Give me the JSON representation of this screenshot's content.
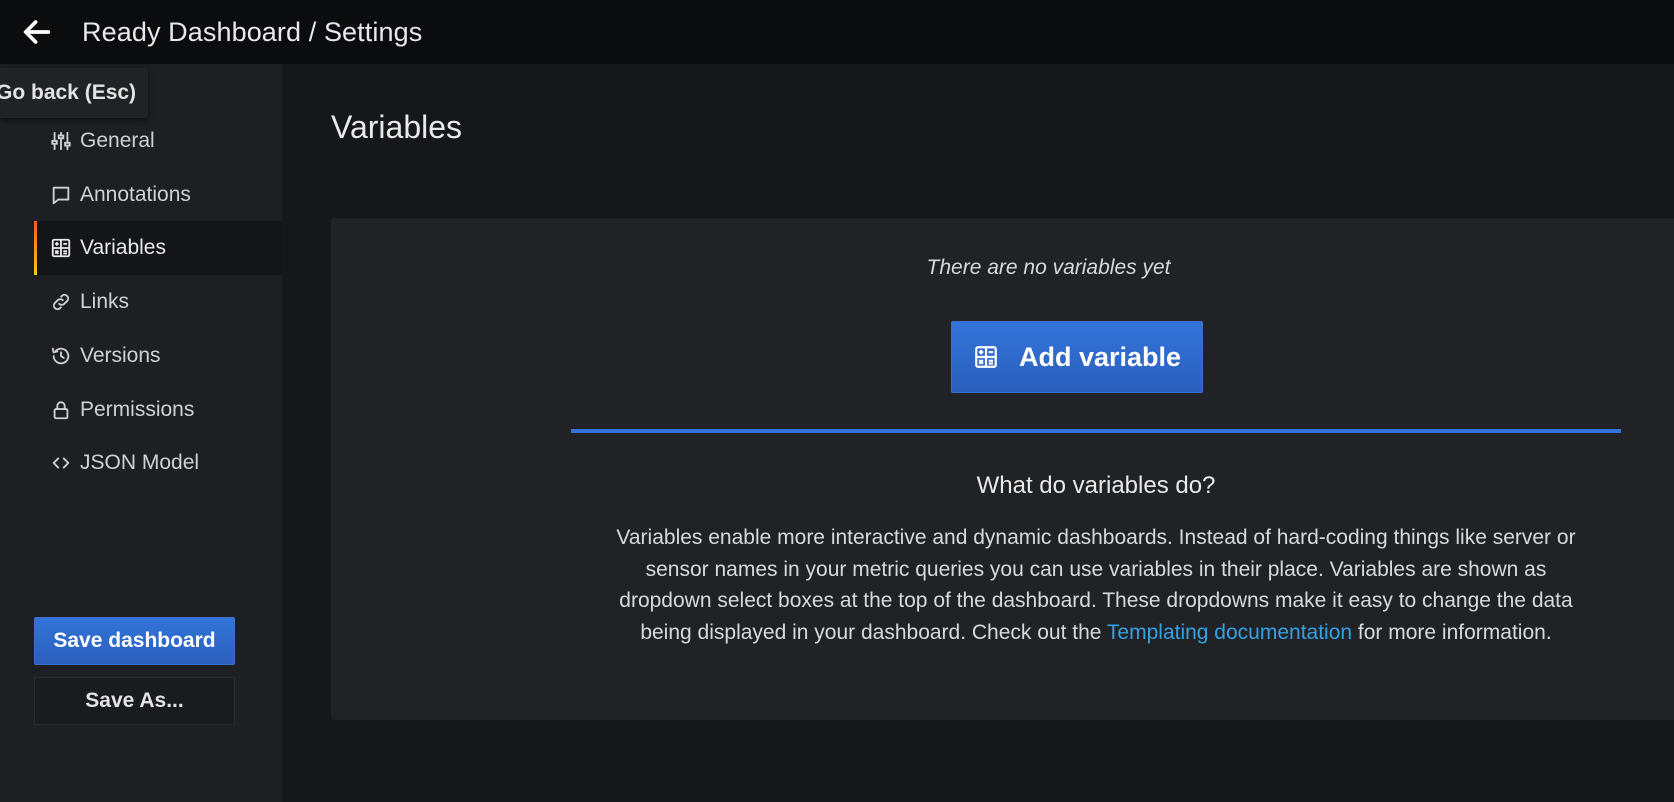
{
  "topbar": {
    "title": "Ready Dashboard / Settings",
    "back_icon": "arrow-left-icon"
  },
  "tooltip": {
    "text": "Go back (Esc)"
  },
  "sidebar": {
    "items": [
      {
        "label": "General",
        "icon": "sliders-icon",
        "active": false
      },
      {
        "label": "Annotations",
        "icon": "comment-icon",
        "active": false
      },
      {
        "label": "Variables",
        "icon": "calculator-icon",
        "active": true
      },
      {
        "label": "Links",
        "icon": "link-icon",
        "active": false
      },
      {
        "label": "Versions",
        "icon": "history-icon",
        "active": false
      },
      {
        "label": "Permissions",
        "icon": "lock-icon",
        "active": false
      },
      {
        "label": "JSON Model",
        "icon": "code-icon",
        "active": false
      }
    ],
    "save_label": "Save dashboard",
    "save_as_label": "Save As..."
  },
  "main": {
    "title": "Variables",
    "empty_text": "There are no variables yet",
    "add_button_label": "Add variable",
    "help_heading": "What do variables do?",
    "help_text_before": "Variables enable more interactive and dynamic dashboards. Instead of hard-coding things like server or sensor names in your metric queries you can use variables in their place. Variables are shown as dropdown select boxes at the top of the dashboard. These dropdowns make it easy to change the data being displayed in your dashboard. Check out the ",
    "help_link_text": "Templating documentation",
    "help_text_after": " for more information."
  },
  "colors": {
    "accent": "#3274d9",
    "link": "#33a2e5",
    "active_bar_top": "#f05a28",
    "active_bar_bottom": "#fbca0a"
  }
}
